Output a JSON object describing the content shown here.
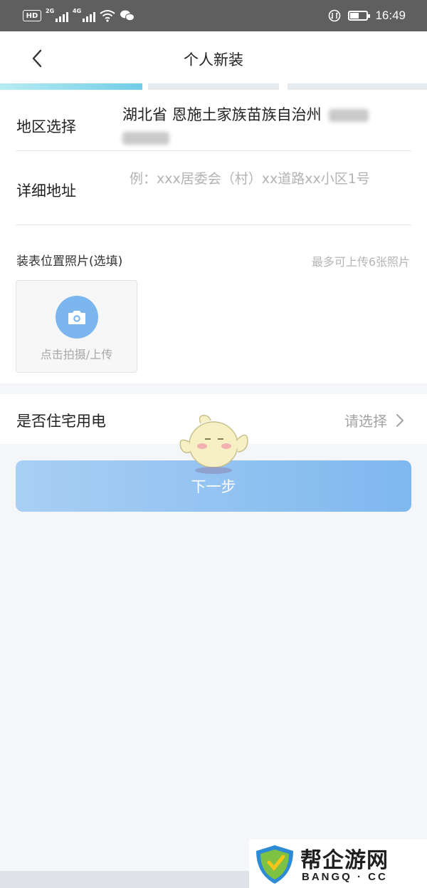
{
  "status_bar": {
    "hd_label": "HD",
    "net1_label": "2G",
    "net2_label": "4G",
    "time": "16:49"
  },
  "nav": {
    "title": "个人新装",
    "back_icon": "chevron-left-icon"
  },
  "progress": {
    "steps_total": 3,
    "current_step": 1,
    "active_color": "#70cde6",
    "inactive_color": "#e6ebf0"
  },
  "form": {
    "region": {
      "label": "地区选择",
      "value": "湖北省 恩施土家族苗族自治州"
    },
    "address": {
      "label": "详细地址",
      "value": "",
      "placeholder": "例：xxx居委会（村）xx道路xx小区1号"
    },
    "photos": {
      "label": "装表位置照片(选填)",
      "hint": "最多可上传6张照片",
      "upload_label": "点击拍摄/上传",
      "upload_icon": "camera-icon"
    },
    "residential": {
      "label": "是否住宅用电",
      "value": "请选择",
      "icon": "chevron-right-icon"
    }
  },
  "next_button": {
    "label": "下一步"
  },
  "watermark": {
    "big": "帮企游网",
    "small": "BANGQ · CC"
  },
  "colors": {
    "accent": "#7eb8ef",
    "camera": "#7cb6ef",
    "background": "#f4f6f9"
  }
}
